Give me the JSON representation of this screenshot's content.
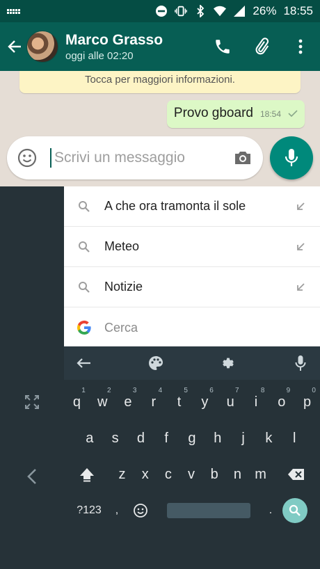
{
  "status_bar": {
    "battery": "26%",
    "time": "18:55"
  },
  "header": {
    "contact_name": "Marco Grasso",
    "last_seen": "oggi alle 02:20"
  },
  "chat": {
    "notice": "Tocca per maggiori informazioni.",
    "messages": [
      {
        "text": "Provo gboard",
        "time": "18:54"
      }
    ]
  },
  "composer": {
    "placeholder": "Scrivi un messaggio"
  },
  "suggestions": [
    {
      "label": "A che ora tramonta il sole"
    },
    {
      "label": "Meteo"
    },
    {
      "label": "Notizie"
    }
  ],
  "search_prompt": "Cerca",
  "keyboard": {
    "row1": [
      {
        "k": "q",
        "h": "1"
      },
      {
        "k": "w",
        "h": "2"
      },
      {
        "k": "e",
        "h": "3"
      },
      {
        "k": "r",
        "h": "4"
      },
      {
        "k": "t",
        "h": "5"
      },
      {
        "k": "y",
        "h": "6"
      },
      {
        "k": "u",
        "h": "7"
      },
      {
        "k": "i",
        "h": "8"
      },
      {
        "k": "o",
        "h": "9"
      },
      {
        "k": "p",
        "h": "0"
      }
    ],
    "row2": [
      "a",
      "s",
      "d",
      "f",
      "g",
      "h",
      "j",
      "k",
      "l"
    ],
    "row3": [
      "z",
      "x",
      "c",
      "v",
      "b",
      "n",
      "m"
    ],
    "symbols_key": "?123",
    "comma_key": ",",
    "period_key": "."
  },
  "colors": {
    "primary_dark": "#054d44",
    "primary": "#075e54",
    "accent": "#00897b",
    "chat_bg": "#e5ddd5",
    "bubble_out": "#dcf8c6",
    "keyboard_bg": "#263238",
    "search_key": "#80cbc4"
  }
}
